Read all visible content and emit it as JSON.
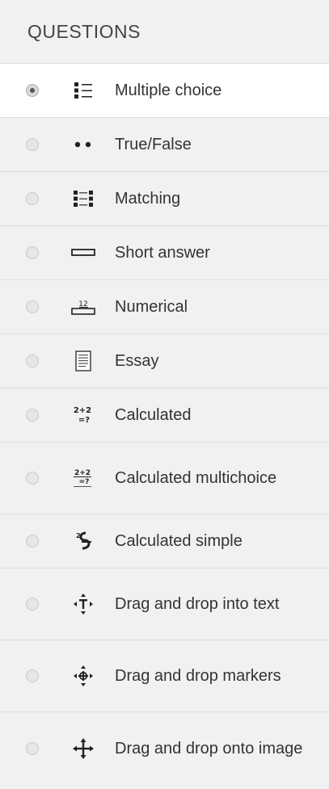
{
  "header": {
    "title": "QUESTIONS"
  },
  "items": [
    {
      "label": "Multiple choice",
      "icon": "multiple-choice-icon",
      "selected": true
    },
    {
      "label": "True/False",
      "icon": "true-false-icon",
      "selected": false
    },
    {
      "label": "Matching",
      "icon": "matching-icon",
      "selected": false
    },
    {
      "label": "Short answer",
      "icon": "short-answer-icon",
      "selected": false
    },
    {
      "label": "Numerical",
      "icon": "numerical-icon",
      "selected": false
    },
    {
      "label": "Essay",
      "icon": "essay-icon",
      "selected": false
    },
    {
      "label": "Calculated",
      "icon": "calculated-icon",
      "selected": false
    },
    {
      "label": "Calculated multichoice",
      "icon": "calculated-multichoice-icon",
      "selected": false
    },
    {
      "label": "Calculated simple",
      "icon": "calculated-simple-icon",
      "selected": false
    },
    {
      "label": "Drag and drop into text",
      "icon": "drag-drop-text-icon",
      "selected": false
    },
    {
      "label": "Drag and drop markers",
      "icon": "drag-drop-markers-icon",
      "selected": false
    },
    {
      "label": "Drag and drop onto image",
      "icon": "drag-drop-image-icon",
      "selected": false
    }
  ],
  "icon_texts": {
    "numerical": "12",
    "calculated_top": "2+2",
    "calculated_bottom": "=?",
    "calc_multi_top": "2+2",
    "calc_multi_bottom": "=?",
    "calc_simple": "2"
  }
}
